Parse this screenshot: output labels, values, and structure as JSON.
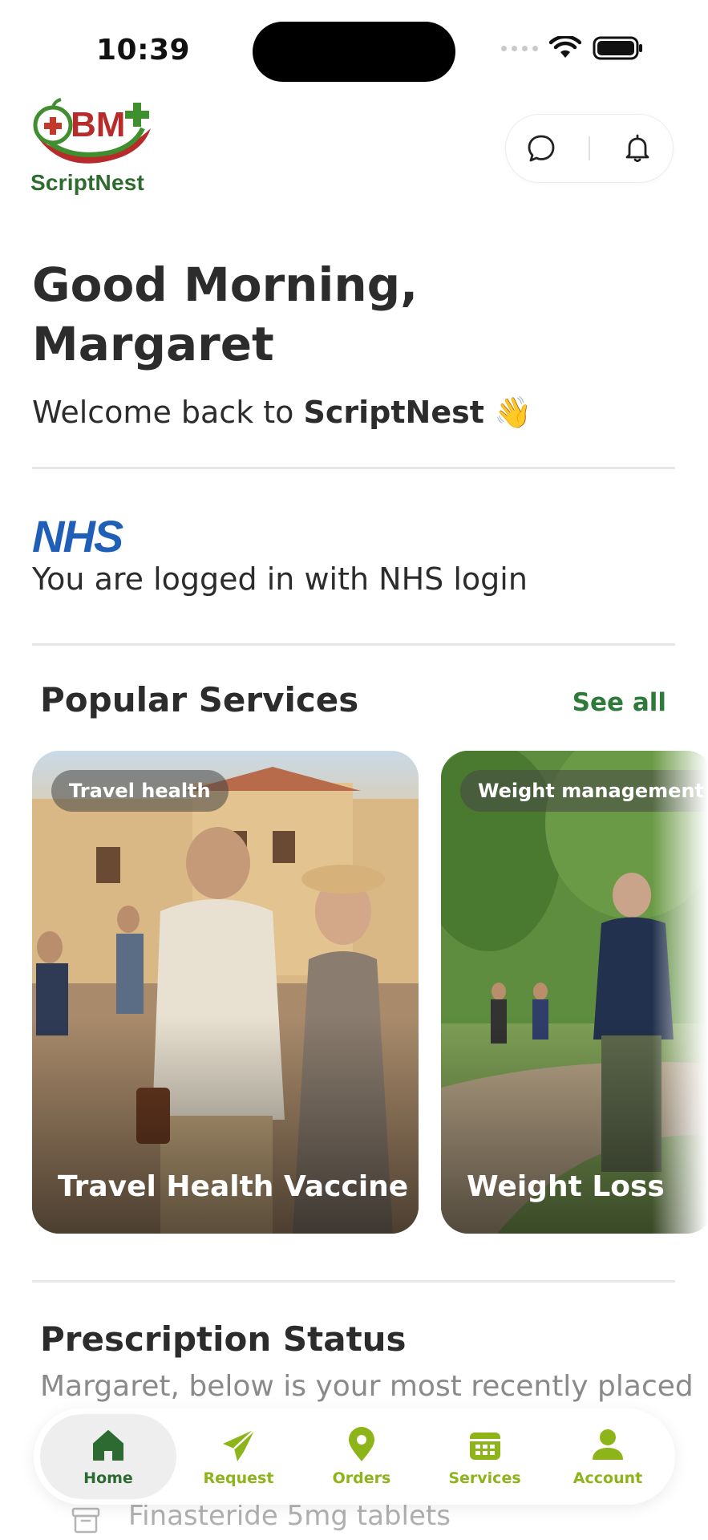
{
  "status_bar": {
    "time": "10:39"
  },
  "header": {
    "logo_initials": "BM",
    "logo_text": "ScriptNest"
  },
  "greeting": {
    "title": "Good Morning, Margaret",
    "welcome_prefix": "Welcome back to ",
    "welcome_brand": "ScriptNest",
    "welcome_emoji": "👋"
  },
  "nhs": {
    "logo": "NHS",
    "message": "You are logged in with NHS login"
  },
  "popular_services": {
    "title": "Popular Services",
    "see_all": "See all",
    "cards": [
      {
        "tag": "Travel health",
        "title": "Travel Health Vaccine"
      },
      {
        "tag": "Weight management",
        "title": "Weight Loss"
      }
    ]
  },
  "prescription_status": {
    "title": "Prescription Status",
    "subtitle": "Margaret, below is your most recently placed",
    "item": "Finasteride 5mg tablets"
  },
  "bottom_nav": {
    "items": [
      {
        "label": "Home",
        "icon": "home-icon",
        "active": true
      },
      {
        "label": "Request",
        "icon": "paper-plane-icon",
        "active": false
      },
      {
        "label": "Orders",
        "icon": "location-pin-icon",
        "active": false
      },
      {
        "label": "Services",
        "icon": "calendar-icon",
        "active": false
      },
      {
        "label": "Account",
        "icon": "user-icon",
        "active": false
      }
    ]
  },
  "colors": {
    "brand_green": "#2d6a32",
    "nav_accent": "#8db51a",
    "nhs_blue": "#1f5fb8",
    "see_all": "#2e7a3a"
  }
}
